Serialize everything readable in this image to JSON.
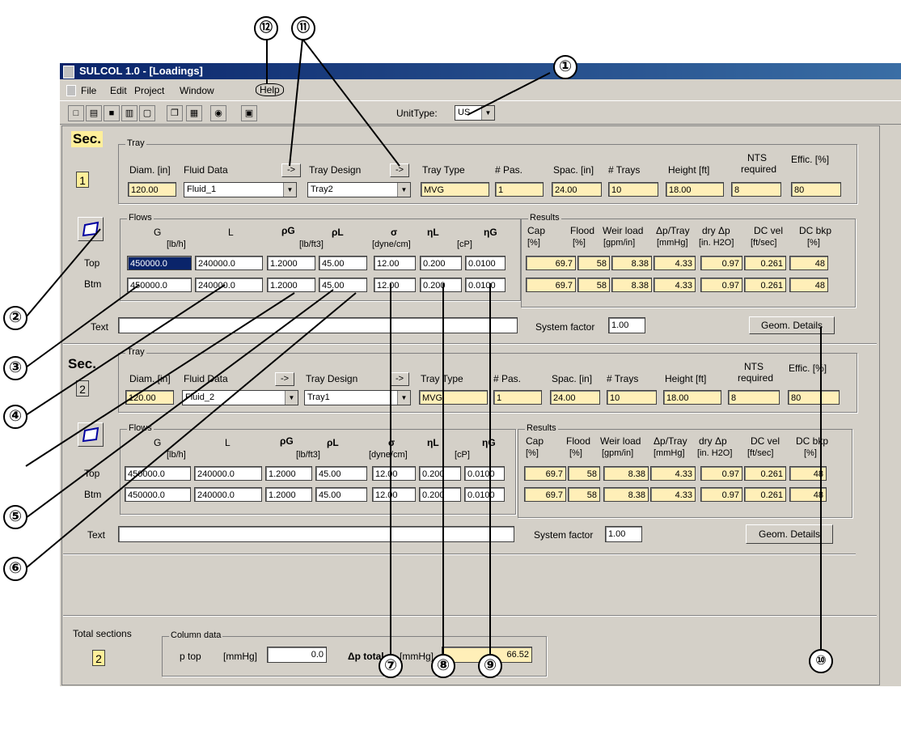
{
  "window": {
    "title": "SULCOL 1.0 - [Loadings]"
  },
  "menu": [
    "File",
    "Edit",
    "Project",
    "Window",
    "Help"
  ],
  "toolbar": {
    "unit_type_label": "UnitType:",
    "unit_type_value": "US"
  },
  "labels": {
    "sec": "Sec.",
    "tray_group": "Tray",
    "diam": "Diam. [in]",
    "fluid_data": "Fluid Data",
    "arrow": "->",
    "tray_design": "Tray Design",
    "tray_type": "Tray Type",
    "passes": "# Pas.",
    "spacing": "Spac. [in]",
    "n_trays": "# Trays",
    "height": "Height [ft]",
    "nts": "NTS",
    "nts_req": "required",
    "effic": "Effic. [%]",
    "flows_group": "Flows",
    "G": "G",
    "L": "L",
    "lbh": "[lb/h]",
    "rhoG": "ρG",
    "rhoL": "ρL",
    "lbft3": "[lb/ft3]",
    "sigma": "σ",
    "dyne": "[dyne/cm]",
    "etaL": "ηL",
    "etaG": "ηG",
    "cP": "[cP]",
    "top": "Top",
    "btm": "Btm",
    "results_group": "Results",
    "cap": "Cap",
    "flood": "Flood",
    "weir": "Weir load",
    "dp_tray": "Δp/Tray",
    "dry_dp": "dry Δp",
    "dc_vel": "DC vel",
    "dc_bkp": "DC bkp",
    "pct": "[%]",
    "gpmin": "[gpm/in]",
    "mmhg": "[mmHg]",
    "inh2o": "[in. H2O]",
    "ftsec": "[ft/sec]",
    "text": "Text",
    "system_factor": "System factor",
    "geom_details": "Geom. Details",
    "total_sections": "Total sections",
    "column_data": "Column data",
    "ptop": "p top",
    "mmhg_b": "[mmHg]",
    "dptotal": "Δp total",
    "mmhg_c": "[mmHg]"
  },
  "sections": [
    {
      "num": "1",
      "diam": "120.00",
      "fluid": "Fluid_1",
      "design": "Tray2",
      "type": "MVG",
      "passes": "1",
      "spacing": "24.00",
      "trays": "10",
      "height": "18.00",
      "nts": "8",
      "effic": "80",
      "top": {
        "G": "450000.0",
        "L": "240000.0",
        "rhoG": "1.2000",
        "rhoL": "45.00",
        "sigma": "12.00",
        "etaL": "0.200",
        "etaG": "0.0100"
      },
      "btm": {
        "G": "450000.0",
        "L": "240000.0",
        "rhoG": "1.2000",
        "rhoL": "45.00",
        "sigma": "12.00",
        "etaL": "0.200",
        "etaG": "0.0100"
      },
      "res_top": {
        "cap": "69.7",
        "flood": "58",
        "weir": "8.38",
        "dp": "4.33",
        "dry": "0.97",
        "dcvel": "0.261",
        "dcbkp": "48"
      },
      "res_btm": {
        "cap": "69.7",
        "flood": "58",
        "weir": "8.38",
        "dp": "4.33",
        "dry": "0.97",
        "dcvel": "0.261",
        "dcbkp": "48"
      },
      "system_factor": "1.00",
      "text": ""
    },
    {
      "num": "2",
      "diam": "120.00",
      "fluid": "Fluid_2",
      "design": "Tray1",
      "type": "MVG",
      "passes": "1",
      "spacing": "24.00",
      "trays": "10",
      "height": "18.00",
      "nts": "8",
      "effic": "80",
      "top": {
        "G": "450000.0",
        "L": "240000.0",
        "rhoG": "1.2000",
        "rhoL": "45.00",
        "sigma": "12.00",
        "etaL": "0.200",
        "etaG": "0.0100"
      },
      "btm": {
        "G": "450000.0",
        "L": "240000.0",
        "rhoG": "1.2000",
        "rhoL": "45.00",
        "sigma": "12.00",
        "etaL": "0.200",
        "etaG": "0.0100"
      },
      "res_top": {
        "cap": "69.7",
        "flood": "58",
        "weir": "8.38",
        "dp": "4.33",
        "dry": "0.97",
        "dcvel": "0.261",
        "dcbkp": "48"
      },
      "res_btm": {
        "cap": "69.7",
        "flood": "58",
        "weir": "8.38",
        "dp": "4.33",
        "dry": "0.97",
        "dcvel": "0.261",
        "dcbkp": "48"
      },
      "system_factor": "1.00",
      "text": ""
    }
  ],
  "bottom": {
    "total_sections": "2",
    "ptop": "0.0",
    "dptotal": "66.52"
  },
  "callouts": [
    "①",
    "②",
    "③",
    "④",
    "⑤",
    "⑥",
    "⑦",
    "⑧",
    "⑨",
    "⑩",
    "⑪",
    "⑫"
  ]
}
